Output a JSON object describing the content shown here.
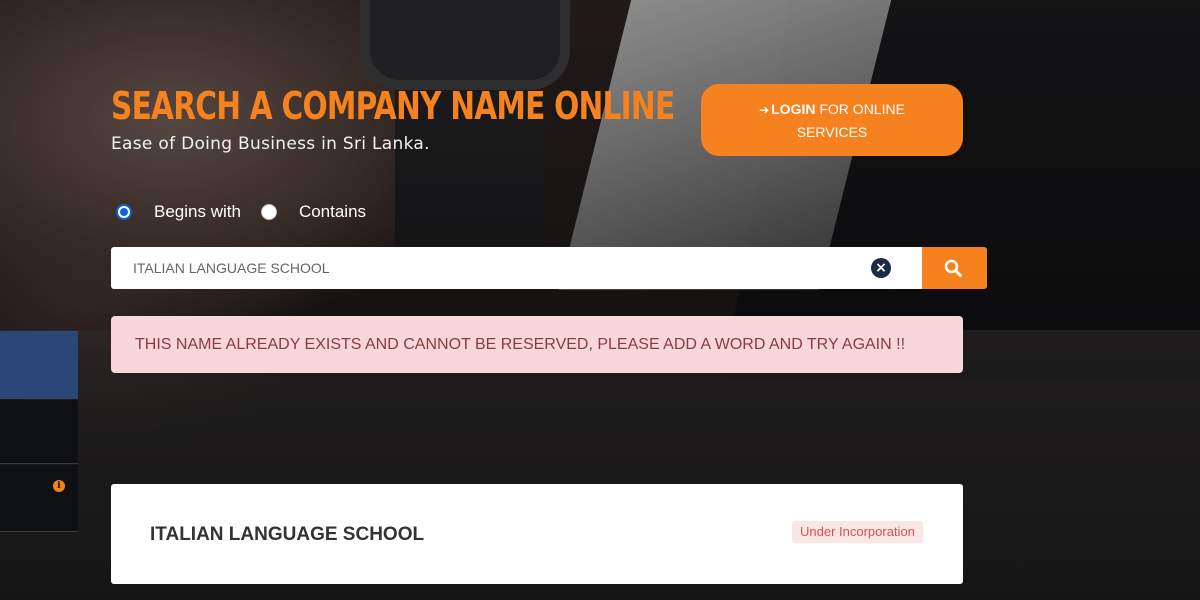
{
  "hero": {
    "title": "SEARCH A COMPANY NAME ONLINE",
    "subtitle": "Ease of Doing Business in Sri Lanka."
  },
  "login_button": {
    "bold_label": "LOGIN",
    "line1_rest": " FOR ONLINE",
    "line2": "SERVICES",
    "icon": "sign-in-icon"
  },
  "search_mode": {
    "options": [
      "Begins with",
      "Contains"
    ],
    "selected": "Begins with"
  },
  "search": {
    "value": "ITALIAN LANGUAGE SCHOOL",
    "clear_icon": "close-circle-icon",
    "submit_icon": "search-icon"
  },
  "alert": {
    "message": "THIS NAME ALREADY EXISTS AND CANNOT BE RESERVED, PLEASE ADD A WORD AND TRY AGAIN !!"
  },
  "results": [
    {
      "name": "ITALIAN LANGUAGE SCHOOL",
      "status": "Under Incorporation"
    }
  ],
  "colors": {
    "accent": "#f5821f",
    "alert_bg": "#f8d7da",
    "alert_text": "#8a3b3f",
    "status_text": "#d9534f",
    "side_blue": "#2a4777"
  }
}
